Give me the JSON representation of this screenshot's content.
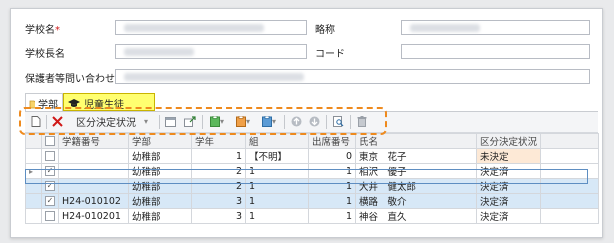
{
  "form": {
    "school_name_label": "学校名",
    "required_mark": "*",
    "abbrev_label": "略称",
    "principal_label": "学校長名",
    "code_label": "コード",
    "guardian_contact_label": "保護者等問い合わせ先"
  },
  "tabs": [
    {
      "label": "学部"
    },
    {
      "label": "児童生徒"
    }
  ],
  "toolbar": {
    "decision_status_label": "区分決定状況"
  },
  "grid": {
    "columns": [
      "",
      "学籍番号",
      "学部",
      "学年",
      "組",
      "出席番号",
      "氏名",
      "区分決定状況"
    ],
    "rows": [
      {
        "checked": false,
        "id": "",
        "dept": "幼稚部",
        "grade": "1",
        "cls": "【不明】",
        "seat": "0",
        "name": "東京　花子",
        "status": "未決定"
      },
      {
        "checked": true,
        "id": "",
        "dept": "幼稚部",
        "grade": "2",
        "cls": "1",
        "seat": "1",
        "name": "相沢　優子",
        "status": "決定済"
      },
      {
        "checked": true,
        "id": "",
        "dept": "幼稚部",
        "grade": "2",
        "cls": "1",
        "seat": "1",
        "name": "大井　健太郎",
        "status": "決定済"
      },
      {
        "checked": true,
        "id": "H24-010102",
        "dept": "幼稚部",
        "grade": "3",
        "cls": "1",
        "seat": "1",
        "name": "横路　敬介",
        "status": "決定済"
      },
      {
        "checked": false,
        "id": "H24-010201",
        "dept": "幼稚部",
        "grade": "3",
        "cls": "1",
        "seat": "1",
        "name": "神谷　直久",
        "status": "決定済"
      }
    ]
  },
  "colors": {
    "highlight_tab": "#ffff70",
    "annotation_dash": "#ee8a1e",
    "selected_row": "#d7e8f7",
    "pending_status": "#fde9d6"
  }
}
